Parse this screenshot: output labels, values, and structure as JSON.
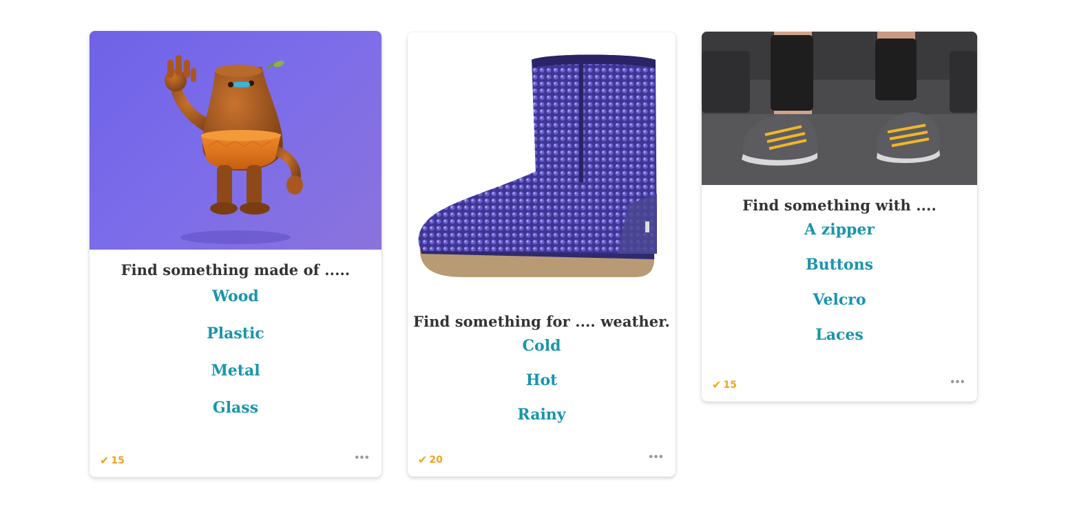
{
  "cards": [
    {
      "image": "waving-wooden-character",
      "title": "Find something made of .....",
      "options": [
        "Wood",
        "Plastic",
        "Metal",
        "Glass"
      ],
      "votes": "15",
      "colors": {
        "background": "#7466e6"
      }
    },
    {
      "image": "purple-sequin-boot",
      "title": "Find something for .... weather.",
      "options": [
        "Cold",
        "Hot",
        "Rainy"
      ],
      "votes": "20"
    },
    {
      "image": "sneakers-with-laces",
      "title": "Find something with ....",
      "options": [
        "A zipper",
        "Buttons",
        "Velcro",
        "Laces"
      ],
      "votes": "15"
    }
  ],
  "icons": {
    "vote": "check-icon",
    "menu": "more-options-icon"
  },
  "colors": {
    "option_text": "#1895ad",
    "title_text": "#333333",
    "vote_accent": "#f0a21e",
    "menu_dots": "#9a9a9a"
  }
}
